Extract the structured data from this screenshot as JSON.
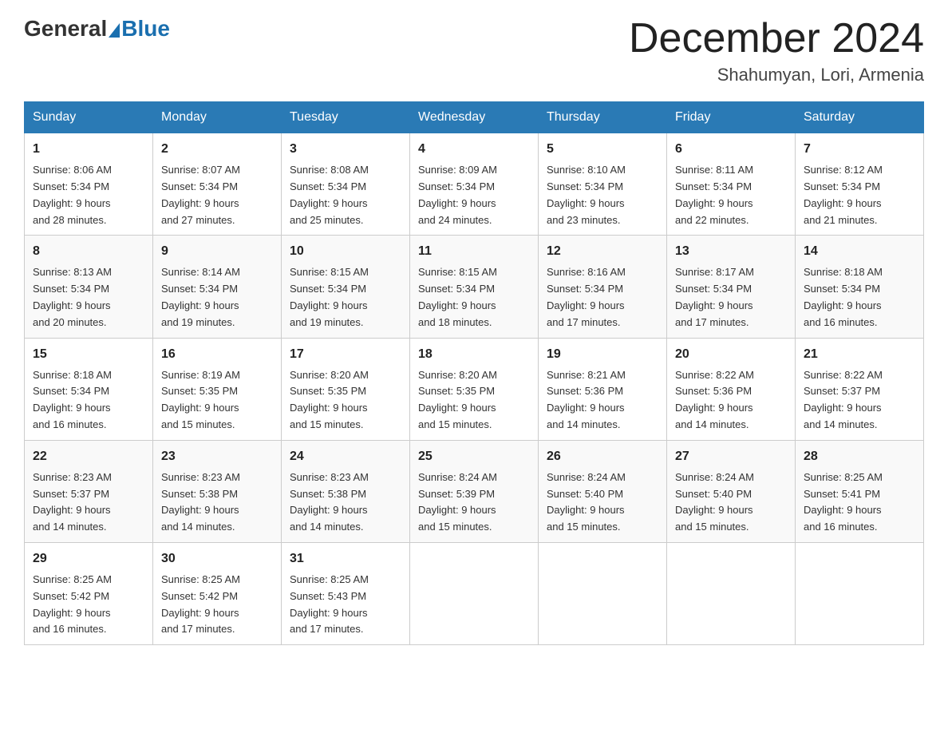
{
  "logo": {
    "general": "General",
    "blue": "Blue"
  },
  "header": {
    "month": "December 2024",
    "location": "Shahumyan, Lori, Armenia"
  },
  "days_of_week": [
    "Sunday",
    "Monday",
    "Tuesday",
    "Wednesday",
    "Thursday",
    "Friday",
    "Saturday"
  ],
  "weeks": [
    [
      {
        "day": "1",
        "sunrise": "8:06 AM",
        "sunset": "5:34 PM",
        "daylight": "9 hours and 28 minutes."
      },
      {
        "day": "2",
        "sunrise": "8:07 AM",
        "sunset": "5:34 PM",
        "daylight": "9 hours and 27 minutes."
      },
      {
        "day": "3",
        "sunrise": "8:08 AM",
        "sunset": "5:34 PM",
        "daylight": "9 hours and 25 minutes."
      },
      {
        "day": "4",
        "sunrise": "8:09 AM",
        "sunset": "5:34 PM",
        "daylight": "9 hours and 24 minutes."
      },
      {
        "day": "5",
        "sunrise": "8:10 AM",
        "sunset": "5:34 PM",
        "daylight": "9 hours and 23 minutes."
      },
      {
        "day": "6",
        "sunrise": "8:11 AM",
        "sunset": "5:34 PM",
        "daylight": "9 hours and 22 minutes."
      },
      {
        "day": "7",
        "sunrise": "8:12 AM",
        "sunset": "5:34 PM",
        "daylight": "9 hours and 21 minutes."
      }
    ],
    [
      {
        "day": "8",
        "sunrise": "8:13 AM",
        "sunset": "5:34 PM",
        "daylight": "9 hours and 20 minutes."
      },
      {
        "day": "9",
        "sunrise": "8:14 AM",
        "sunset": "5:34 PM",
        "daylight": "9 hours and 19 minutes."
      },
      {
        "day": "10",
        "sunrise": "8:15 AM",
        "sunset": "5:34 PM",
        "daylight": "9 hours and 19 minutes."
      },
      {
        "day": "11",
        "sunrise": "8:15 AM",
        "sunset": "5:34 PM",
        "daylight": "9 hours and 18 minutes."
      },
      {
        "day": "12",
        "sunrise": "8:16 AM",
        "sunset": "5:34 PM",
        "daylight": "9 hours and 17 minutes."
      },
      {
        "day": "13",
        "sunrise": "8:17 AM",
        "sunset": "5:34 PM",
        "daylight": "9 hours and 17 minutes."
      },
      {
        "day": "14",
        "sunrise": "8:18 AM",
        "sunset": "5:34 PM",
        "daylight": "9 hours and 16 minutes."
      }
    ],
    [
      {
        "day": "15",
        "sunrise": "8:18 AM",
        "sunset": "5:34 PM",
        "daylight": "9 hours and 16 minutes."
      },
      {
        "day": "16",
        "sunrise": "8:19 AM",
        "sunset": "5:35 PM",
        "daylight": "9 hours and 15 minutes."
      },
      {
        "day": "17",
        "sunrise": "8:20 AM",
        "sunset": "5:35 PM",
        "daylight": "9 hours and 15 minutes."
      },
      {
        "day": "18",
        "sunrise": "8:20 AM",
        "sunset": "5:35 PM",
        "daylight": "9 hours and 15 minutes."
      },
      {
        "day": "19",
        "sunrise": "8:21 AM",
        "sunset": "5:36 PM",
        "daylight": "9 hours and 14 minutes."
      },
      {
        "day": "20",
        "sunrise": "8:22 AM",
        "sunset": "5:36 PM",
        "daylight": "9 hours and 14 minutes."
      },
      {
        "day": "21",
        "sunrise": "8:22 AM",
        "sunset": "5:37 PM",
        "daylight": "9 hours and 14 minutes."
      }
    ],
    [
      {
        "day": "22",
        "sunrise": "8:23 AM",
        "sunset": "5:37 PM",
        "daylight": "9 hours and 14 minutes."
      },
      {
        "day": "23",
        "sunrise": "8:23 AM",
        "sunset": "5:38 PM",
        "daylight": "9 hours and 14 minutes."
      },
      {
        "day": "24",
        "sunrise": "8:23 AM",
        "sunset": "5:38 PM",
        "daylight": "9 hours and 14 minutes."
      },
      {
        "day": "25",
        "sunrise": "8:24 AM",
        "sunset": "5:39 PM",
        "daylight": "9 hours and 15 minutes."
      },
      {
        "day": "26",
        "sunrise": "8:24 AM",
        "sunset": "5:40 PM",
        "daylight": "9 hours and 15 minutes."
      },
      {
        "day": "27",
        "sunrise": "8:24 AM",
        "sunset": "5:40 PM",
        "daylight": "9 hours and 15 minutes."
      },
      {
        "day": "28",
        "sunrise": "8:25 AM",
        "sunset": "5:41 PM",
        "daylight": "9 hours and 16 minutes."
      }
    ],
    [
      {
        "day": "29",
        "sunrise": "8:25 AM",
        "sunset": "5:42 PM",
        "daylight": "9 hours and 16 minutes."
      },
      {
        "day": "30",
        "sunrise": "8:25 AM",
        "sunset": "5:42 PM",
        "daylight": "9 hours and 17 minutes."
      },
      {
        "day": "31",
        "sunrise": "8:25 AM",
        "sunset": "5:43 PM",
        "daylight": "9 hours and 17 minutes."
      },
      null,
      null,
      null,
      null
    ]
  ],
  "labels": {
    "sunrise": "Sunrise:",
    "sunset": "Sunset:",
    "daylight": "Daylight:"
  }
}
